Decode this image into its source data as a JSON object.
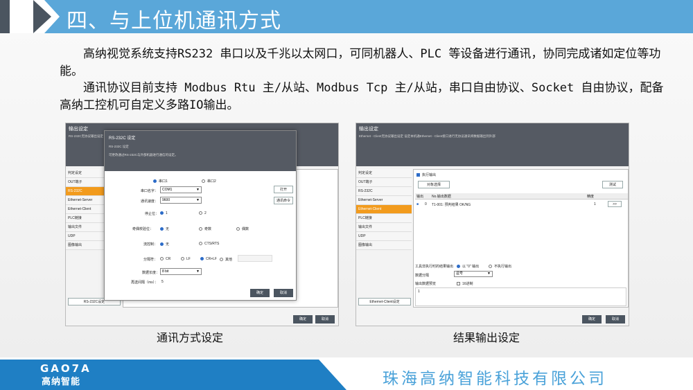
{
  "header": {
    "title": "四、与上位机通讯方式"
  },
  "body": {
    "para1": "高纳视觉系统支持RS232 串口以及千兆以太网口，可同机器人、PLC 等设备进行通讯，协同完成诸如定位等功能。",
    "para2": "通讯协议目前支持 Modbus Rtu 主/从站、Modbus Tcp 主/从站，串口自由协议、Socket 自由协议，配备高纳工控机可自定义多路IO输出。"
  },
  "left_shot": {
    "window_title": "输出设定",
    "window_desc": "RS-232C无协议输出设定 设定本机通RS-232C向外部输出",
    "sidebar": [
      "判定设定",
      "OUT端子",
      "RS-232C",
      "Ethernet-Server",
      "Ethernet-Client",
      "PLC链接",
      "输出文件",
      "UDP",
      "图像输出"
    ],
    "active_index": 2,
    "side_button": "RS-232C设定",
    "ok": "确定",
    "cancel": "取消",
    "dialog": {
      "title": "RS-232C 设定",
      "subtitle": "RS-232C 设定",
      "desc": "可更改通过RS-232C与外部机器进行通信的设定。",
      "port1": "串口1",
      "port2": "串口2",
      "port_name_label": "串口名字：",
      "port_name": "COM1",
      "baud_label": "通讯速度：",
      "baud": "9600",
      "open_btn": "打开",
      "query_btn": "通讯命令",
      "stop_label": "停止位：",
      "stop_1": "1",
      "stop_2": "2",
      "parity_label": "奇偶校验位：",
      "parity_none": "无",
      "parity_odd": "奇数",
      "parity_even": "偶数",
      "flow_label": "流控制：",
      "flow_none": "无",
      "flow_cts": "CTS/RTS",
      "delim_label": "分隔符：",
      "delim_cr": "CR",
      "delim_lf": "LF",
      "delim_crlf": "CR+LF",
      "delim_other": "其他",
      "databits_label": "数据长度：",
      "databits": "8 bit",
      "timeout_label": "再送间隔（ms）：",
      "timeout": "5",
      "ok": "确定",
      "cancel": "取消"
    }
  },
  "right_shot": {
    "window_title": "输出设定",
    "window_desc": "Ethernet - Client无协议输出设定 设定本机通Ethernet - Client接口进行无协议通讯将数据输出到外部",
    "sidebar": [
      "判定设定",
      "OUT端子",
      "RS-232C",
      "Ethernet-Server",
      "Ethernet-Client",
      "PLC链接",
      "输出文件",
      "UDP",
      "图像输出"
    ],
    "active_index": 4,
    "exec_output": "执行输出",
    "select_btn": "对象选择",
    "test_btn": "测试",
    "col_output": "输出",
    "col_no": "No.输出数据",
    "col_precision": "精度",
    "row_no": "0",
    "row_data": "T1-001: 预判结果 OK/NG",
    "row_precision": "1",
    "row_arrow": ">>",
    "ng_label": "工具非执行时的结果输出",
    "ng_zero": "以 \"0\" 输出",
    "ng_skip": "不执行输出",
    "sep_label": "数据分隔",
    "sep_value": "逗号",
    "preview_label": "输出数据预览",
    "hex_label": "16进制",
    "preview_value": "1",
    "side_button": "Ethernet-Client设定",
    "ok": "确定",
    "cancel": "取消"
  },
  "captions": {
    "left": "通讯方式设定",
    "right": "结果输出设定"
  },
  "footer": {
    "logo": "GAO7A",
    "logo_cn": "高纳智能",
    "company": "珠海高纳智能科技有限公司"
  }
}
